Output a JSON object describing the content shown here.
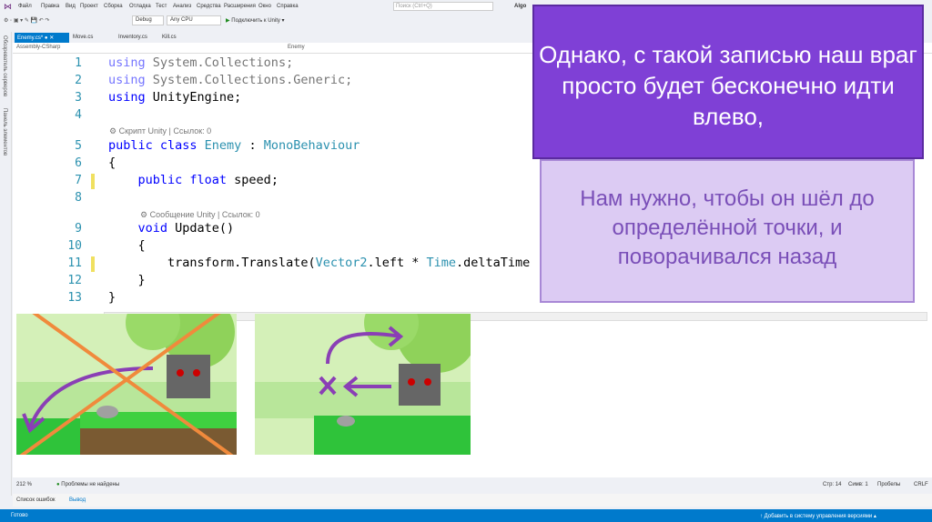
{
  "menu": [
    "Файл",
    "Правка",
    "Вид",
    "Проект",
    "Сборка",
    "Отладка",
    "Тест",
    "Анализ",
    "Средства",
    "Расширения",
    "Окно",
    "Справка"
  ],
  "search_placeholder": "Поиск (Ctrl+Q)",
  "window_title": "Algo",
  "toolbar": {
    "config": "Debug",
    "platform": "Any CPU",
    "attach": "Подключить к Unity"
  },
  "side_panels": [
    "Обозреватель серверов",
    "Панель элементов"
  ],
  "tabs": [
    "Enemy.cs*",
    "Move.cs",
    "Inventory.cs",
    "Kill.cs"
  ],
  "nav": {
    "project": "Assembly-CSharp",
    "class": "Enemy"
  },
  "hints": {
    "class": "Скрипт Unity | Ссылок: 0",
    "method": "Сообщение Unity | Ссылок: 0"
  },
  "line_numbers": [
    "1",
    "2",
    "3",
    "4",
    "5",
    "6",
    "7",
    "8",
    "9",
    "10",
    "11",
    "12",
    "13"
  ],
  "code": {
    "l1a": "using",
    "l1b": " System.Collections;",
    "l2a": "using",
    "l2b": " System.Collections.Generic;",
    "l3a": "using",
    "l3b": " UnityEngine;",
    "l5a": "public class ",
    "l5b": "Enemy",
    "l5c": " : ",
    "l5d": "MonoBehaviour",
    "l6": "{",
    "l7a": "    public float",
    "l7b": " speed;",
    "l9a": "    void ",
    "l9b": "Update()",
    "l10": "    {",
    "l11a": "        transform.Translate(",
    "l11b": "Vector2",
    "l11c": ".left * ",
    "l11d": "Time",
    "l11e": ".deltaTime",
    "l12": "    }",
    "l13": "}"
  },
  "status": {
    "zoom": "212 %",
    "problems": "Проблемы не найдены",
    "line": "Стр: 14",
    "col": "Симв: 1",
    "spaces": "Пробелы",
    "eol": "CRLF"
  },
  "bottom_tabs": [
    "Список ошибок",
    "Вывод"
  ],
  "vs_status": {
    "ready": "Готово",
    "vcs": "Добавить в систему управления версиями"
  },
  "slide": {
    "box1": "Однако, с такой записью наш враг просто будет бесконечно идти влево,",
    "box2": "Нам нужно, чтобы он шёл до определённой точки, и поворачивался назад"
  },
  "colors": {
    "purple": "#7f40d6",
    "light_purple": "#dccbf3",
    "cross": "#f08a3c",
    "arrow": "#8a3fb5"
  }
}
